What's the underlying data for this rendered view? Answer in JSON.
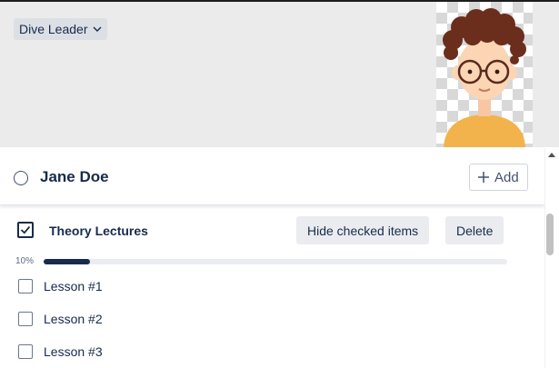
{
  "header": {
    "role_dropdown": {
      "label": "Dive Leader",
      "icon": "chevron-down-icon"
    },
    "background_color": "#ebebeb"
  },
  "avatar": {
    "icon": "cartoon-person-avatar"
  },
  "card": {
    "title": "Jane Doe",
    "add_button_label": "Add",
    "add_icon": "plus-icon"
  },
  "checklist": {
    "title": "Theory Lectures",
    "hide_checked_label": "Hide checked items",
    "delete_label": "Delete",
    "progress_text": "10%",
    "progress_value": 0.1,
    "items": [
      {
        "label": "Lesson #1",
        "checked": false
      },
      {
        "label": "Lesson #2",
        "checked": false
      },
      {
        "label": "Lesson #3",
        "checked": false
      }
    ]
  },
  "colors": {
    "text": "#172b4d",
    "button_gray": "#ebecf0",
    "progress_fill": "#172b4d",
    "avatar_hair": "#6b2e1c",
    "avatar_shirt": "#f2b34c"
  }
}
